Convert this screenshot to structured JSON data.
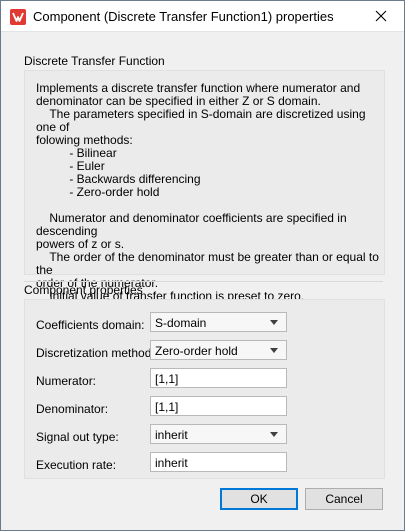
{
  "window": {
    "title": "Component (Discrete Transfer Function1) properties",
    "app_icon": "app-logo-icon",
    "close_icon": "close-icon"
  },
  "description": {
    "section_label": "Discrete Transfer Function",
    "text": "Implements a discrete transfer function where numerator and\ndenominator can be specified in either Z or S domain.\n    The parameters specified in S-domain are discretized using one of\nfolowing methods:\n          - Bilinear\n          - Euler\n          - Backwards differencing\n          - Zero-order hold\n\n    Numerator and denominator coefficients are specified in descending\npowers of z or s.\n    The order of the denominator must be greater than or equal to the\norder of the numerator.\n    Initial value of transfer function is preset to zero."
  },
  "properties": {
    "section_label": "Component properties",
    "rows": [
      {
        "label": "Coefficients domain:",
        "value": "S-domain",
        "type": "select"
      },
      {
        "label": "Discretization method:",
        "value": "Zero-order hold",
        "type": "select"
      },
      {
        "label": "Numerator:",
        "value": "[1,1]",
        "type": "text"
      },
      {
        "label": "Denominator:",
        "value": "[1,1]",
        "type": "text"
      },
      {
        "label": "Signal out type:",
        "value": "inherit",
        "type": "select"
      },
      {
        "label": "Execution rate:",
        "value": "inherit",
        "type": "text"
      }
    ]
  },
  "buttons": {
    "ok": "OK",
    "cancel": "Cancel"
  },
  "colors": {
    "accent": "#0078d7",
    "icon_red": "#e03a32"
  }
}
